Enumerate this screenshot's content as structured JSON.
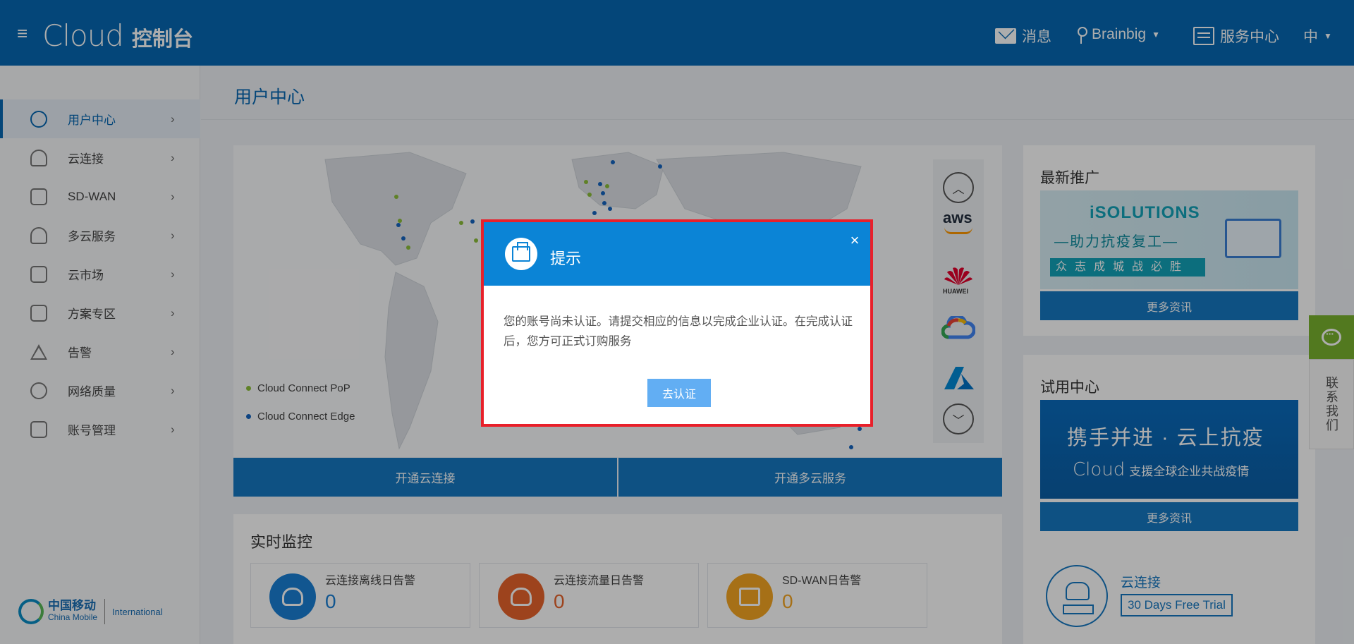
{
  "header": {
    "logo_cloud": "Cloud",
    "logo_console": "控制台",
    "messages": "消息",
    "user": "Brainbig",
    "service_center": "服务中心",
    "language": "中"
  },
  "sidebar": {
    "items": [
      {
        "label": "用户中心",
        "icon": "user-circle-icon",
        "active": true
      },
      {
        "label": "云连接",
        "icon": "cloud-upload-icon"
      },
      {
        "label": "SD-WAN",
        "icon": "router-icon"
      },
      {
        "label": "多云服务",
        "icon": "cloud-icon"
      },
      {
        "label": "云市场",
        "icon": "market-icon"
      },
      {
        "label": "方案专区",
        "icon": "server-icon"
      },
      {
        "label": "告警",
        "icon": "warning-icon"
      },
      {
        "label": "网络质量",
        "icon": "globe-icon"
      },
      {
        "label": "账号管理",
        "icon": "account-icon"
      }
    ],
    "footer_logo_zh": "中国移动",
    "footer_logo_en": "China Mobile",
    "footer_intl": "International"
  },
  "main": {
    "page_title": "用户中心",
    "legend": [
      {
        "label": "Cloud Connect PoP",
        "color": "#8dbf3a"
      },
      {
        "label": "Cloud Connect Edge",
        "color": "#1565c0"
      }
    ],
    "cloud_providers": {
      "aws": "aws",
      "huawei": "HUAWEI"
    },
    "btn_open_cloud_connect": "开通云连接",
    "btn_open_multicloud": "开通多云服务",
    "monitor_title": "实时监控",
    "monitor_cards": [
      {
        "label": "云连接离线日告警",
        "value": "0",
        "color": "#1a7fd4"
      },
      {
        "label": "云连接流量日告警",
        "value": "0",
        "color": "#e8632b"
      },
      {
        "label": "SD-WAN日告警",
        "value": "0",
        "color": "#f5a623"
      }
    ]
  },
  "right": {
    "promo_title": "最新推广",
    "promo_banner_title": "iSOLUTIONS",
    "promo_banner_sub": "—助力抗疫复工—",
    "promo_banner_slogan": "众志成城战必胜",
    "promo_more": "更多资讯",
    "trial_title": "试用中心",
    "trial_banner_title": "携手并进 · 云上抗疫",
    "trial_banner_sub": "支援全球企业共战疫情",
    "trial_banner_logo": "Cloud",
    "trial_more": "更多资讯",
    "trial_item_name": "云连接",
    "trial_item_badge": "30 Days Free Trial"
  },
  "contact": {
    "label": "联系我们"
  },
  "dialog": {
    "title": "提示",
    "message": "您的账号尚未认证。请提交相应的信息以完成企业认证。在完成认证后，您方可正式订购服务",
    "button": "去认证",
    "close": "×"
  }
}
